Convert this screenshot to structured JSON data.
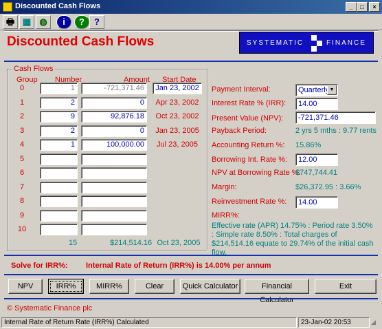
{
  "window": {
    "title": "Discounted Cash Flows",
    "minimize": "_",
    "maximize": "□",
    "close": "×"
  },
  "toolbar": [
    {
      "icon": "print-icon",
      "glyph": "🖶"
    },
    {
      "icon": "calculator-icon",
      "glyph": "▦"
    },
    {
      "icon": "globe-icon",
      "glyph": "◍"
    },
    {
      "icon": "info-icon",
      "glyph": "i"
    },
    {
      "icon": "help-icon",
      "glyph": "?"
    },
    {
      "icon": "context-help-icon",
      "glyph": "?"
    }
  ],
  "header": {
    "title": "Discounted Cash Flows",
    "logo_left": "SYSTEMATIC",
    "logo_right": "FINANCE"
  },
  "cashflows": {
    "legend": "Cash Flows",
    "headers": {
      "group": "Group",
      "number": "Number",
      "amount": "Amount",
      "start_date": "Start Date"
    },
    "rows": [
      {
        "group": "0",
        "number": "1",
        "amount": "-721,371.46",
        "start_date": "Jan 23, 2002"
      },
      {
        "group": "1",
        "number": "2",
        "amount": "0",
        "start_date": "Apr 23, 2002"
      },
      {
        "group": "2",
        "number": "9",
        "amount": "92,876.18",
        "start_date": "Oct 23, 2002"
      },
      {
        "group": "3",
        "number": "2",
        "amount": "0",
        "start_date": "Jan 23, 2005"
      },
      {
        "group": "4",
        "number": "1",
        "amount": "100,000.00",
        "start_date": "Jul 23, 2005"
      },
      {
        "group": "5",
        "number": "",
        "amount": "",
        "start_date": ""
      },
      {
        "group": "6",
        "number": "",
        "amount": "",
        "start_date": ""
      },
      {
        "group": "7",
        "number": "",
        "amount": "",
        "start_date": ""
      },
      {
        "group": "8",
        "number": "",
        "amount": "",
        "start_date": ""
      },
      {
        "group": "9",
        "number": "",
        "amount": "",
        "start_date": ""
      },
      {
        "group": "10",
        "number": "",
        "amount": "",
        "start_date": ""
      }
    ],
    "totals": {
      "number": "15",
      "amount": "$214,514.16",
      "date": "Oct 23, 2005"
    }
  },
  "right": {
    "payment_interval": {
      "label": "Payment Interval:",
      "value": "Quarterly"
    },
    "irr": {
      "label": "Interest Rate % (IRR):",
      "value": "14.00"
    },
    "npv": {
      "label": "Present Value (NPV):",
      "value": "-721,371.46"
    },
    "payback": {
      "label": "Payback Period:",
      "value": "2 yrs 5 mths : 9.77 rents"
    },
    "accounting_return": {
      "label": "Accounting Return %:",
      "value": "15.86%"
    },
    "borrowing_rate": {
      "label": "Borrowing Int. Rate %:",
      "value": "12.00"
    },
    "npv_borrowing": {
      "label": "NPV at Borrowing Rate %:",
      "value": "$747,744.41"
    },
    "margin": {
      "label": "Margin:",
      "value": "$26,372.95 : 3.66%"
    },
    "reinvestment_rate": {
      "label": "Reinvestment Rate %:",
      "value": "14.00"
    },
    "mirr": {
      "label": "MIRR%:",
      "value": ""
    },
    "effective_note": "Effective rate (APR) 14.75% : Period rate 3.50% : Simple rate 8.50% : Total charges of $214,514.16 equate to 29.74% of the initial cash flow."
  },
  "solve": {
    "label": "Solve for IRR%:",
    "message": "Internal Rate of Return (IRR%) is 14.00% per annum"
  },
  "buttons": [
    "NPV",
    "IRR%",
    "MIRR%",
    "Clear",
    "Quick Calculator",
    "Financial Calculator",
    "Exit"
  ],
  "footer": {
    "copyright": "© Systematic Finance plc"
  },
  "status": {
    "message": "Internal Rate of Return Rate (IRR%) Calculated",
    "datetime": "23-Jan-02 20:53"
  }
}
